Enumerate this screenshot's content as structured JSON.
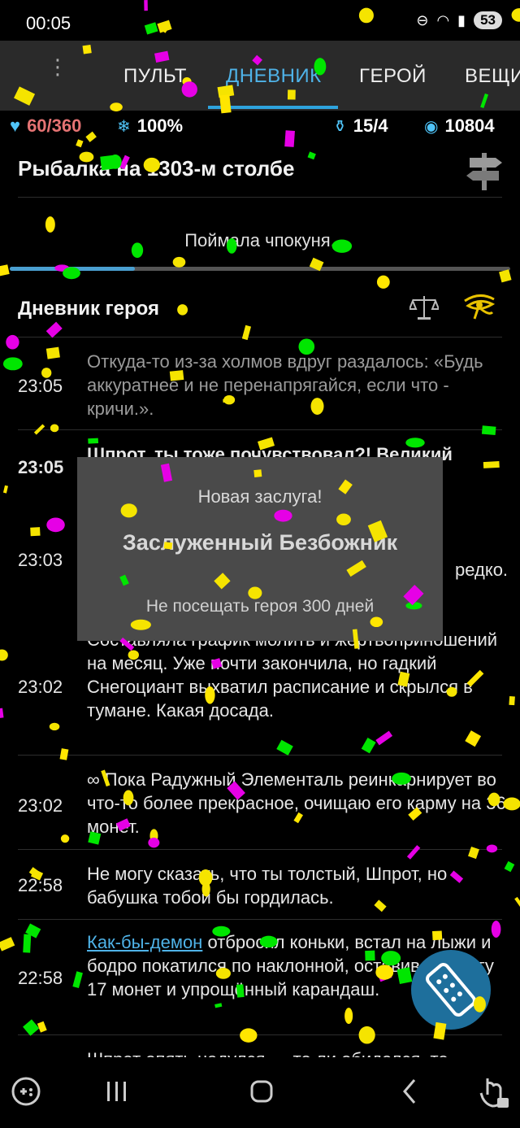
{
  "status": {
    "time": "00:05",
    "battery": "53"
  },
  "tabs": [
    {
      "label": "ПУЛЬТ",
      "active": false
    },
    {
      "label": "ДНЕВНИК",
      "active": true
    },
    {
      "label": "ГЕРОЙ",
      "active": false
    },
    {
      "label": "ВЕЩИ",
      "active": false
    }
  ],
  "stats": {
    "health": "60/360",
    "godpower": "100%",
    "inventory": "15/4",
    "gold": "10804"
  },
  "quest": {
    "title": "Рыбалка на 1303-м столбе",
    "progress_text": "Поймала чпокуня.",
    "progress": 0.25
  },
  "diary": {
    "title": "Дневник героя",
    "entries": [
      {
        "time": "23:05",
        "text": "Откуда-то из-за холмов вдруг раздалось: «Будь аккуратнее и не перенапрягайся, если что - кричи.».",
        "style": "grey"
      },
      {
        "time": "23:05",
        "text": "Шпрот, ты тоже почувствовал?! Великий",
        "style": "bold"
      },
      {
        "time": "23:03",
        "text": "редко.",
        "style": "normal"
      },
      {
        "time": "23:02",
        "text": "Составляла график молитв и жертвоприношений на месяц. Уже почти закончила, но гадкий Снегоциант выхватил расписание и скрылся в тумане. Какая досада.",
        "style": "normal"
      },
      {
        "time": "23:02",
        "text": "Пока Радужный Элементаль реинкарнирует во что-то более прекрасное, очищаю его карму на 36 монет.",
        "style": "normal",
        "icon": "infinity-icon"
      },
      {
        "time": "22:58",
        "text": "Не могу сказать, что ты толстый, Шпрот, но бабушка тобой бы гордилась.",
        "style": "normal"
      },
      {
        "time": "22:58",
        "link": "Как-бы-демон",
        "text": " отбросил коньки, встал на лыжи и бодро покатился по наклонной, оставив на снегу 17 монет и упрощённый карандаш.",
        "style": "normal"
      },
      {
        "time": "",
        "text": "Шпрот опять надулся — то ли обиделся, то",
        "style": "normal"
      }
    ]
  },
  "popup": {
    "kicker": "Новая заслуга!",
    "title": "Заслуженный Безбожник",
    "description": "Не посещать героя 300 дней"
  },
  "colors": {
    "accent": "#4fb3e8",
    "health": "#e57373",
    "confetti": [
      "#f5e400",
      "#e600e6",
      "#00e600",
      "#ffe600"
    ]
  }
}
